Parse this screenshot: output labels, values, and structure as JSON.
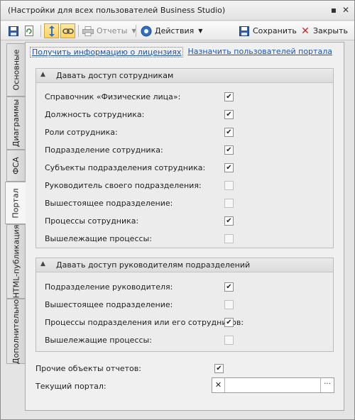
{
  "window": {
    "title": "(Настройки для всех пользователей Business Studio)"
  },
  "titlebar_buttons": [
    "pin-icon",
    "close-icon"
  ],
  "toolbar": {
    "reports_label": "Отчеты",
    "actions_label": "Действия",
    "save_label": "Сохранить",
    "close_label": "Закрыть"
  },
  "links": {
    "license_info": "Получить информацию о лицензиях",
    "assign_users": "Назначить пользователей портала"
  },
  "tabs": [
    {
      "label": "Основные",
      "active": false
    },
    {
      "label": "Диаграммы",
      "active": false
    },
    {
      "label": "ФСА",
      "active": false
    },
    {
      "label": "Портал",
      "active": true
    },
    {
      "label": "HTML-публикация",
      "active": false
    },
    {
      "label": "Дополнительно",
      "active": false
    }
  ],
  "group1": {
    "title": "Давать доступ сотрудникам",
    "items": [
      {
        "label": "Справочник «Физические лица»:",
        "checked": true
      },
      {
        "label": "Должность сотрудника:",
        "checked": true
      },
      {
        "label": "Роли сотрудника:",
        "checked": true
      },
      {
        "label": "Подразделение сотрудника:",
        "checked": true
      },
      {
        "label": "Субъекты подразделения сотрудника:",
        "checked": true
      },
      {
        "label": "Руководитель своего подразделения:",
        "checked": false
      },
      {
        "label": "Вышестоящее подразделение:",
        "checked": false
      },
      {
        "label": "Процессы сотрудника:",
        "checked": true
      },
      {
        "label": "Вышележащие процессы:",
        "checked": false
      }
    ]
  },
  "group2": {
    "title": "Давать доступ руководителям подразделений",
    "items": [
      {
        "label": "Подразделение руководителя:",
        "checked": true
      },
      {
        "label": "Вышестоящее подразделение:",
        "checked": false
      },
      {
        "label": "Процессы подразделения или его сотрудников:",
        "checked": true
      },
      {
        "label": "Вышележащие процессы:",
        "checked": false
      }
    ]
  },
  "other_objects": {
    "label": "Прочие объекты отчетов:",
    "checked": true
  },
  "current_portal": {
    "label": "Текущий портал:",
    "value": "",
    "clear_symbol": "✕",
    "browse_symbol": "···"
  }
}
